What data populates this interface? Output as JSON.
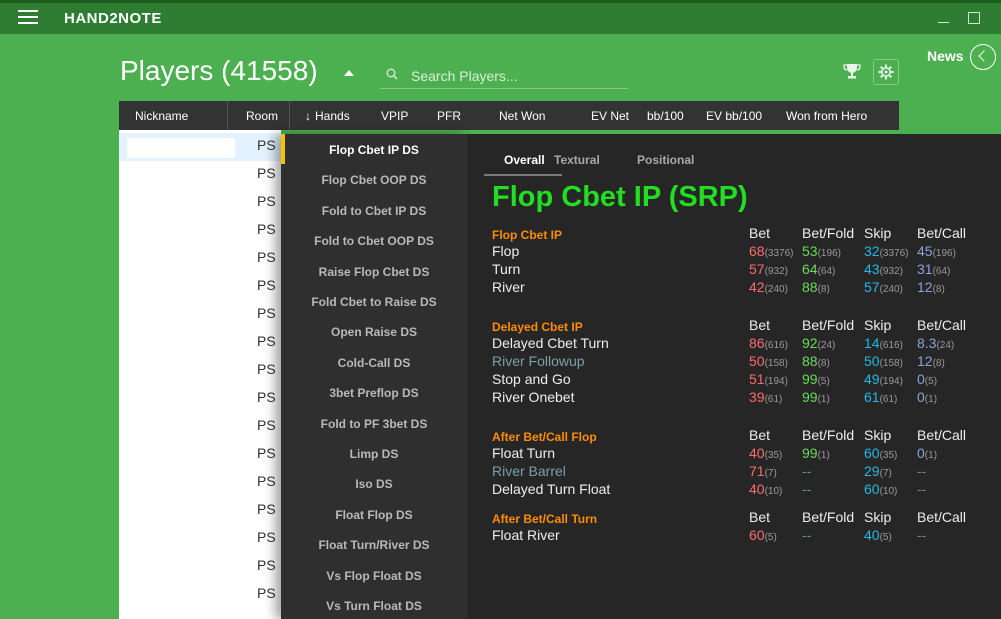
{
  "app": {
    "title": "HAND2NOTE"
  },
  "header": {
    "title": "Players (41558)",
    "search_placeholder": "Search Players...",
    "news_label": "News"
  },
  "table": {
    "columns": [
      "Nickname",
      "Room",
      "Hands",
      "VPIP",
      "PFR",
      "Net Won",
      "EV Net",
      "bb/100",
      "EV bb/100",
      "Won from Hero"
    ],
    "sorted_column": "Hands",
    "rooms": [
      "PS",
      "PS",
      "PS",
      "PS",
      "PS",
      "PS",
      "PS",
      "PS",
      "PS",
      "PS",
      "PS",
      "PS",
      "PS",
      "PS",
      "PS",
      "PS",
      "PS"
    ]
  },
  "stat_menu": {
    "active": "Flop Cbet IP DS",
    "items": [
      "Flop Cbet IP DS",
      "Flop Cbet OOP DS",
      "Fold to Cbet IP DS",
      "Fold to Cbet OOP DS",
      "Raise Flop Cbet DS",
      "Fold Cbet to Raise DS",
      "Open Raise DS",
      "Cold-Call DS",
      "3bet Preflop DS",
      "Fold to PF 3bet DS",
      "Limp DS",
      "Iso DS",
      "Float Flop DS",
      "Float Turn/River DS",
      "Vs Flop Float DS",
      "Vs Turn Float DS"
    ]
  },
  "stat_panel": {
    "tabs": [
      "Overall",
      "Textural",
      "Positional"
    ],
    "active_tab": "Overall",
    "title": "Flop Cbet IP (SRP)",
    "sections": [
      {
        "heading": "Flop Cbet IP",
        "columns": [
          "Bet",
          "Bet/Fold",
          "Skip",
          "Bet/Call"
        ],
        "rows": [
          {
            "label": "Flop",
            "dim": false,
            "values": [
              [
                "68",
                "(3376)"
              ],
              [
                "53",
                "(196)"
              ],
              [
                "32",
                "(3376)"
              ],
              [
                "45",
                "(196)"
              ]
            ]
          },
          {
            "label": "Turn",
            "dim": false,
            "values": [
              [
                "57",
                "(932)"
              ],
              [
                "64",
                "(64)"
              ],
              [
                "43",
                "(932)"
              ],
              [
                "31",
                "(64)"
              ]
            ]
          },
          {
            "label": "River",
            "dim": false,
            "values": [
              [
                "42",
                "(240)"
              ],
              [
                "88",
                "(8)"
              ],
              [
                "57",
                "(240)"
              ],
              [
                "12",
                "(8)"
              ]
            ]
          }
        ]
      },
      {
        "heading": "Delayed Cbet IP",
        "columns": [
          "Bet",
          "Bet/Fold",
          "Skip",
          "Bet/Call"
        ],
        "rows": [
          {
            "label": "Delayed Cbet Turn",
            "dim": false,
            "values": [
              [
                "86",
                "(616)"
              ],
              [
                "92",
                "(24)"
              ],
              [
                "14",
                "(616)"
              ],
              [
                "8.3",
                "(24)"
              ]
            ]
          },
          {
            "label": "River Followup",
            "dim": true,
            "values": [
              [
                "50",
                "(158)"
              ],
              [
                "88",
                "(8)"
              ],
              [
                "50",
                "(158)"
              ],
              [
                "12",
                "(8)"
              ]
            ]
          },
          {
            "label": "Stop and Go",
            "dim": false,
            "values": [
              [
                "51",
                "(194)"
              ],
              [
                "99",
                "(5)"
              ],
              [
                "49",
                "(194)"
              ],
              [
                "0",
                "(5)"
              ]
            ]
          },
          {
            "label": "River Onebet",
            "dim": false,
            "values": [
              [
                "39",
                "(61)"
              ],
              [
                "99",
                "(1)"
              ],
              [
                "61",
                "(61)"
              ],
              [
                "0",
                "(1)"
              ]
            ]
          }
        ]
      },
      {
        "heading": "After Bet/Call Flop",
        "columns": [
          "Bet",
          "Bet/Fold",
          "Skip",
          "Bet/Call"
        ],
        "rows": [
          {
            "label": "Float Turn",
            "dim": false,
            "values": [
              [
                "40",
                "(35)"
              ],
              [
                "99",
                "(1)"
              ],
              [
                "60",
                "(35)"
              ],
              [
                "0",
                "(1)"
              ]
            ]
          },
          {
            "label": "River Barrel",
            "dim": true,
            "values": [
              [
                "71",
                "(7)"
              ],
              [
                "--",
                ""
              ],
              [
                "29",
                "(7)"
              ],
              [
                "--",
                ""
              ]
            ]
          },
          {
            "label": "Delayed Turn Float",
            "dim": false,
            "values": [
              [
                "40",
                "(10)"
              ],
              [
                "--",
                ""
              ],
              [
                "60",
                "(10)"
              ],
              [
                "--",
                ""
              ]
            ]
          }
        ]
      },
      {
        "heading": "After Bet/Call Turn",
        "columns": [
          "Bet",
          "Bet/Fold",
          "Skip",
          "Bet/Call"
        ],
        "rows": [
          {
            "label": "Float River",
            "dim": false,
            "values": [
              [
                "60",
                "(5)"
              ],
              [
                "--",
                ""
              ],
              [
                "40",
                "(5)"
              ],
              [
                "--",
                ""
              ]
            ]
          }
        ]
      }
    ]
  }
}
